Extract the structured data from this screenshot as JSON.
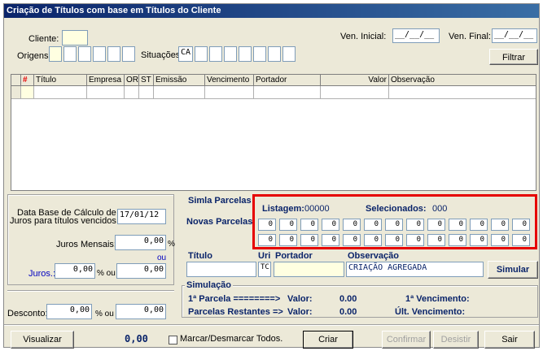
{
  "window": {
    "title": "Criação de Títulos com base em Títulos do Cliente"
  },
  "filters": {
    "cliente_label": "Cliente:",
    "origens_label": "Origens:",
    "situacoes_label": "Situações::",
    "situacoes_first": "CA",
    "ven_inicial_label": "Ven. Inicial:",
    "ven_inicial_value": "__/__/__",
    "ven_final_label": "Ven. Final:",
    "ven_final_value": "__/__/__",
    "filtrar_label": "Filtrar"
  },
  "grid": {
    "marker": "#",
    "columns": [
      "Título",
      "Empresa",
      "OR",
      "ST",
      "Emissão",
      "Vencimento",
      "Portador",
      "Valor",
      "Observação"
    ]
  },
  "calc": {
    "data_base_label_1": "Data Base de Cálculo de",
    "data_base_label_2": "Juros para títulos vencidos",
    "data_base_value": "17/01/12",
    "juros_mensais_label": "Juros Mensais:",
    "juros_mensais_value": "0,00",
    "percent": "%",
    "ou": "ou",
    "juros_label": "Juros.:",
    "juros_pct_value": "0,00",
    "pct_ou": "% ou",
    "juros_val_value": "0,00",
    "desconto_label": "Desconto:",
    "desconto_pct_value": "0,00",
    "desconto_val_value": "0,00"
  },
  "parcelas": {
    "simla_label": "Simla Parcelas",
    "novas_label": "Novas Parcelas",
    "listagem_label": "Listagem:",
    "listagem_value": "00000",
    "selecionados_label": "Selecionados:",
    "selecionados_value": "000",
    "row1": [
      "0",
      "0",
      "0",
      "0",
      "0",
      "0",
      "0",
      "0",
      "0",
      "0",
      "0",
      "0",
      "0"
    ],
    "row2": [
      "0",
      "0",
      "0",
      "0",
      "0",
      "0",
      "0",
      "0",
      "0",
      "0",
      "0",
      "0",
      "0"
    ]
  },
  "titulo": {
    "titulo_label": "Título",
    "uri_label": "Uri",
    "uri_value": "TC",
    "portador_label": "Portador",
    "observacao_label": "Observação",
    "observacao_value": "CRIAÇÃO AGREGADA",
    "simular_label": "Simular"
  },
  "simulacao": {
    "title": "Simulação",
    "line1_label": "1ª Parcela ========>",
    "line2_label": "Parcelas Restantes =>",
    "valor_label": "Valor:",
    "line1_valor": "0.00",
    "line2_valor": "0.00",
    "venc1_label": "1ª Vencimento:",
    "venc2_label": "Últ. Vencimento:"
  },
  "footer": {
    "visualizar_label": "Visualizar",
    "total_value": "0,00",
    "marcar_label": "Marcar/Desmarcar Todos.",
    "criar_label": "Criar",
    "confirmar_label": "Confirmar",
    "desistir_label": "Desistir",
    "sair_label": "Sair"
  },
  "colors": {
    "accent": "#0a246a",
    "highlight": "#e60000",
    "field_yellow": "#ffffe1"
  }
}
